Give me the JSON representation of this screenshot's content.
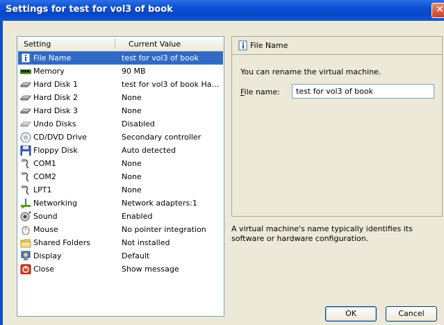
{
  "window": {
    "title": "Settings for test for vol3 of book",
    "close_glyph": "✕"
  },
  "list": {
    "col_setting": "Setting",
    "col_value": "Current Value",
    "rows": [
      {
        "icon": "file-info-icon",
        "name": "File Name",
        "value": "test for vol3 of book",
        "selected": true
      },
      {
        "icon": "memory-icon",
        "name": "Memory",
        "value": "90 MB"
      },
      {
        "icon": "hard-disk-icon",
        "name": "Hard Disk 1",
        "value": "test for vol3 of book Ha..."
      },
      {
        "icon": "hard-disk-icon",
        "name": "Hard Disk 2",
        "value": "None"
      },
      {
        "icon": "hard-disk-icon",
        "name": "Hard Disk 3",
        "value": "None"
      },
      {
        "icon": "undo-disks-icon",
        "name": "Undo Disks",
        "value": "Disabled"
      },
      {
        "icon": "cd-dvd-icon",
        "name": "CD/DVD Drive",
        "value": "Secondary controller"
      },
      {
        "icon": "floppy-icon",
        "name": "Floppy Disk",
        "value": "Auto detected"
      },
      {
        "icon": "com-port-icon",
        "name": "COM1",
        "value": "None"
      },
      {
        "icon": "com-port-icon",
        "name": "COM2",
        "value": "None"
      },
      {
        "icon": "lpt-port-icon",
        "name": "LPT1",
        "value": "None"
      },
      {
        "icon": "networking-icon",
        "name": "Networking",
        "value": "Network adapters:1"
      },
      {
        "icon": "sound-icon",
        "name": "Sound",
        "value": "Enabled"
      },
      {
        "icon": "mouse-icon",
        "name": "Mouse",
        "value": "No pointer integration"
      },
      {
        "icon": "folder-icon",
        "name": "Shared Folders",
        "value": "Not installed"
      },
      {
        "icon": "display-icon",
        "name": "Display",
        "value": "Default"
      },
      {
        "icon": "close-power-icon",
        "name": "Close",
        "value": "Show message"
      }
    ]
  },
  "panel": {
    "header": "File Name",
    "rename_text": "You can rename the virtual machine.",
    "field_label_accel": "F",
    "field_label_rest": "ile name:",
    "field_value": "test for vol3 of book"
  },
  "description": "A virtual machine's name typically identifies its software or hardware configuration.",
  "buttons": {
    "ok": "OK",
    "cancel": "Cancel"
  },
  "colors": {
    "selection": "#316ac5",
    "titlebar": "#0a52d6",
    "dialog_bg": "#ece9d8"
  }
}
